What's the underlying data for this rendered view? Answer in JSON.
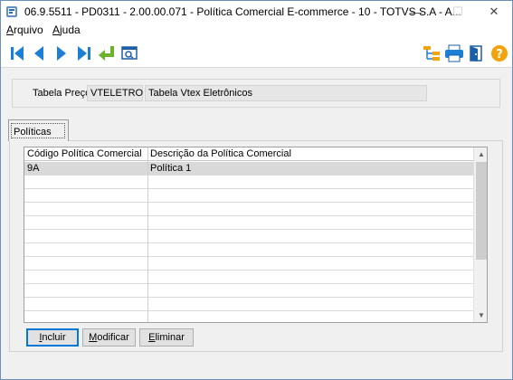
{
  "window": {
    "title": "06.9.5511 - PD0311 - 2.00.00.071 - Política Comercial E-commerce - 10 - TOTVS S.A - A...",
    "minimize_glyph": "—",
    "maximize_glyph": "☐",
    "close_glyph": "✕"
  },
  "menu": {
    "items": [
      {
        "label": "Arquivo",
        "mnemonic": "A",
        "rest": "rquivo"
      },
      {
        "label": "Ajuda",
        "mnemonic": "A",
        "rest": "juda"
      }
    ]
  },
  "toolbar": {
    "buttons": [
      "first-record-icon",
      "previous-record-icon",
      "next-record-icon",
      "last-record-icon",
      "go-to-icon",
      "search-icon",
      "tree-icon",
      "print-icon",
      "exit-icon",
      "help-icon"
    ]
  },
  "header": {
    "label": "Tabela Preço:",
    "code": "VTELETRO",
    "description": "Tabela Vtex Eletrônicos"
  },
  "tabs": [
    {
      "label": "Políticas"
    }
  ],
  "grid": {
    "columns": [
      "Código Política Comercial",
      "Descrição da Política Comercial"
    ],
    "rows": [
      [
        "9A",
        "Política 1"
      ]
    ]
  },
  "buttons": {
    "incluir": {
      "mnemonic": "I",
      "rest": "ncluir"
    },
    "modificar": {
      "mnemonic": "M",
      "rest": "odificar"
    },
    "eliminar": {
      "mnemonic": "E",
      "rest": "liminar"
    }
  },
  "colors": {
    "nav_blue": "#1c7fd6",
    "goto_green": "#6ab32a",
    "help_orange": "#f0a30a",
    "focus_border": "#0078d7"
  }
}
